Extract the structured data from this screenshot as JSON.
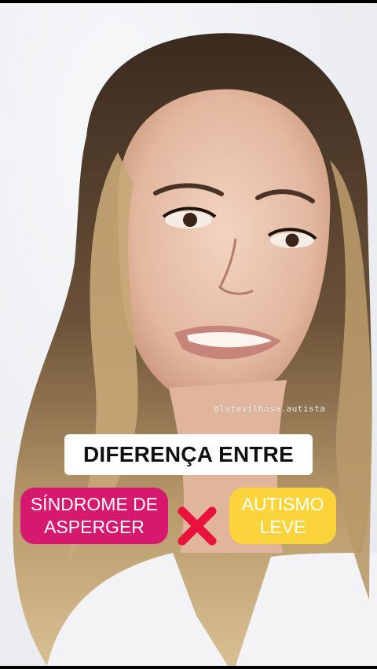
{
  "watermark": "@lstavilhosa.autista",
  "title": "DIFERENÇA ENTRE",
  "left_tag": {
    "line1": "SÍNDROME DE",
    "line2": "ASPERGER"
  },
  "right_tag": {
    "line1": "AUTISMO",
    "line2": "LEVE"
  },
  "versus_icon": "red-x-icon",
  "colors": {
    "left_tag_bg": "#d6196f",
    "right_tag_bg": "#fbd43b",
    "x_mark": "#e8123c",
    "title_bg": "#ffffff"
  }
}
